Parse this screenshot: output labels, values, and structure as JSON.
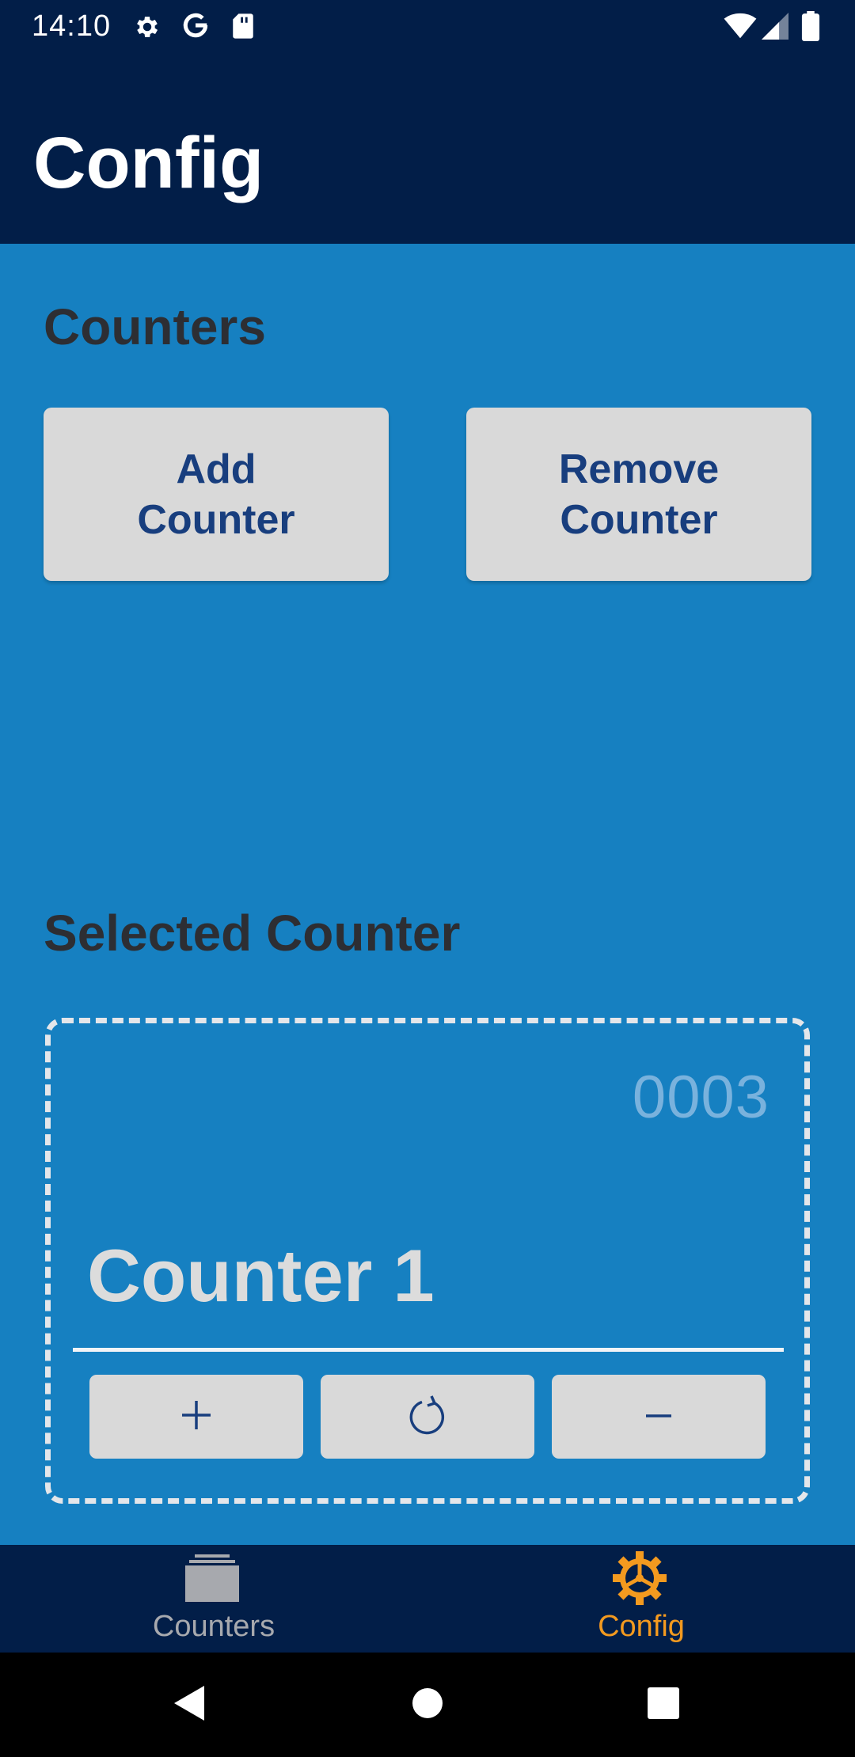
{
  "status_bar": {
    "time": "14:10",
    "left_icons": [
      "gear-icon",
      "google-icon",
      "sd-card-icon"
    ],
    "right_icons": [
      "wifi-icon",
      "signal-icon",
      "battery-icon"
    ]
  },
  "app_bar": {
    "title": "Config"
  },
  "counters_section": {
    "title": "Counters",
    "add_label": "Add Counter",
    "remove_label": "Remove Counter"
  },
  "selected_section": {
    "title": "Selected Counter",
    "counter": {
      "count": "0003",
      "name": "Counter 1",
      "controls": [
        "plus-icon",
        "refresh-icon",
        "minus-icon"
      ]
    }
  },
  "bottom_nav": {
    "items": [
      {
        "label": "Counters",
        "icon": "stack-icon",
        "active": false
      },
      {
        "label": "Config",
        "icon": "gear-icon",
        "active": true
      }
    ]
  },
  "system_nav": [
    "back-icon",
    "home-icon",
    "recents-icon"
  ],
  "colors": {
    "app_bar": "#021e48",
    "content_bg": "#1680c1",
    "accent": "#f39a1f",
    "button_text": "#183e7e",
    "button_bg": "#d9d9d9"
  }
}
